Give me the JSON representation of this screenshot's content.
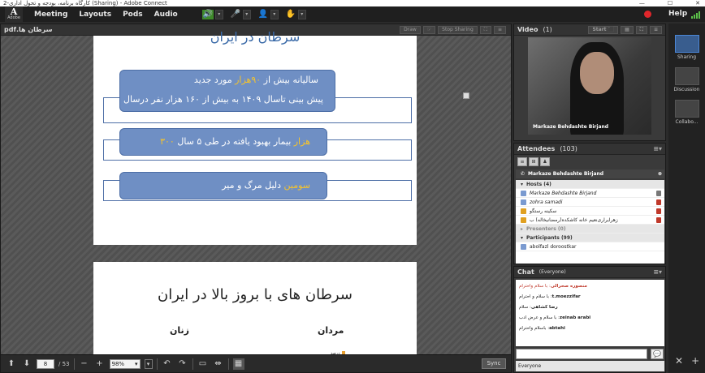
{
  "window": {
    "title": "کارگاه برنامه، بودجه و تحول اداری-2 (Sharing) - Adobe Connect",
    "controls": [
      "—",
      "☐",
      "✕"
    ]
  },
  "menubar": {
    "logo_letter": "A",
    "logo_text": "Adobe",
    "items": [
      "Meeting",
      "Layouts",
      "Pods",
      "Audio"
    ],
    "help": "Help"
  },
  "share": {
    "file_name": "سرطان ها.pdf",
    "buttons": {
      "draw": "Draw",
      "stop_sharing": "Stop Sharing"
    },
    "slide1": {
      "title": "سرطان در ایران",
      "box1_line1": "سالیانه بیش از ",
      "box1_accent1": "۹۰هزار",
      "box1_line1_end": " مورد جدید",
      "box1_line2": "پیش بینی تاسال ۱۴۰۹ به بیش از ۱۶۰ هزار نفر درسال",
      "box2_accent": "۳۰۰ هزار",
      "box2_text": " بیمار بهبود یافته در طی ۵ سال",
      "box3_accent": "سومین",
      "box3_text": " دلیل مرگ و میر"
    },
    "slide2": {
      "title": "سرطان های با بروز بالا در ایران",
      "col_left": "زنان",
      "col_right": "مردان",
      "legend": "درصد"
    },
    "footer": {
      "page": "8",
      "total": "/ 53",
      "zoom": "98%",
      "sync": "Sync"
    }
  },
  "video": {
    "title": "Video",
    "count": "(1)",
    "start_label": "Start",
    "participant_name": "Markaze Behdashte Birjand"
  },
  "attendees": {
    "title": "Attendees",
    "count": "(103)",
    "me": "Markaze Behdashte Birjand",
    "groups": {
      "hosts": "Hosts (4)",
      "presenters": "Presenters (0)",
      "participants": "Participants (99)"
    },
    "hosts": [
      "Markaze Behdashte Birjand",
      "zohra samadi",
      "سکینه رستگو",
      "زهرایراری‌نعیم خانه کاشکده(رمضانیخاله) ب"
    ],
    "participants": [
      "abolfazl doroostkar"
    ]
  },
  "chat": {
    "title": "Chat",
    "scope": "(Everyone)",
    "messages": [
      {
        "sender": "منصوره صحرالی",
        "text": "با سلام واحترام",
        "red": true
      },
      {
        "sender": "t.moezzifar",
        "text": "با سلام و احترام",
        "red": false
      },
      {
        "sender": "رضا کشاهی",
        "text": "سلام",
        "red": false
      },
      {
        "sender": "zeinab arabi",
        "text": "با سلام و عرض ادب",
        "red": false
      },
      {
        "sender": "abtahi",
        "text": "باسلام واحترام",
        "red": false
      }
    ],
    "target": "Everyone"
  },
  "layouts": {
    "items": [
      "Sharing",
      "Discussion",
      "Collabo..."
    ]
  },
  "colors": {
    "accent": "#f6c42b",
    "box": "#6f8fc4",
    "record": "#e0262b"
  }
}
